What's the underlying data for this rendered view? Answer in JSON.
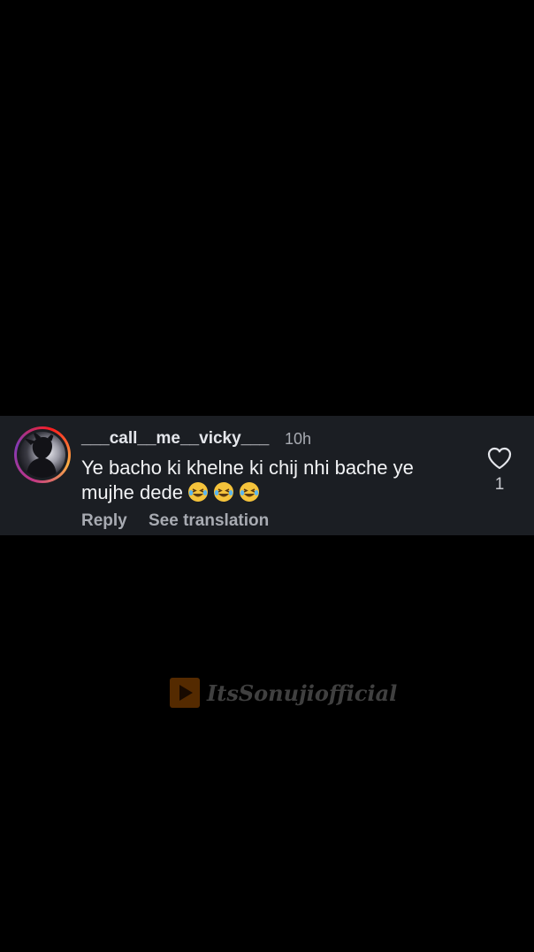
{
  "comment": {
    "username": "___call__me__vicky___",
    "timestamp": "10h",
    "text": "Ye bacho ki khelne ki chij nhi bache ye mujhe dede",
    "emoji": [
      "face-with-tears-of-joy",
      "face-with-tears-of-joy",
      "face-with-tears-of-joy"
    ],
    "reply_label": "Reply",
    "translation_label": "See translation",
    "like_count": "1",
    "like_icon": "heart-outline-icon"
  },
  "watermark": {
    "icon": "play-icon",
    "text": "ItsSonujiofficial",
    "icon_color": "#c86400"
  },
  "colors": {
    "background": "#000000",
    "card_background": "#1b1e23",
    "primary_text": "#f2f3f5",
    "secondary_text": "#a8abb2"
  }
}
